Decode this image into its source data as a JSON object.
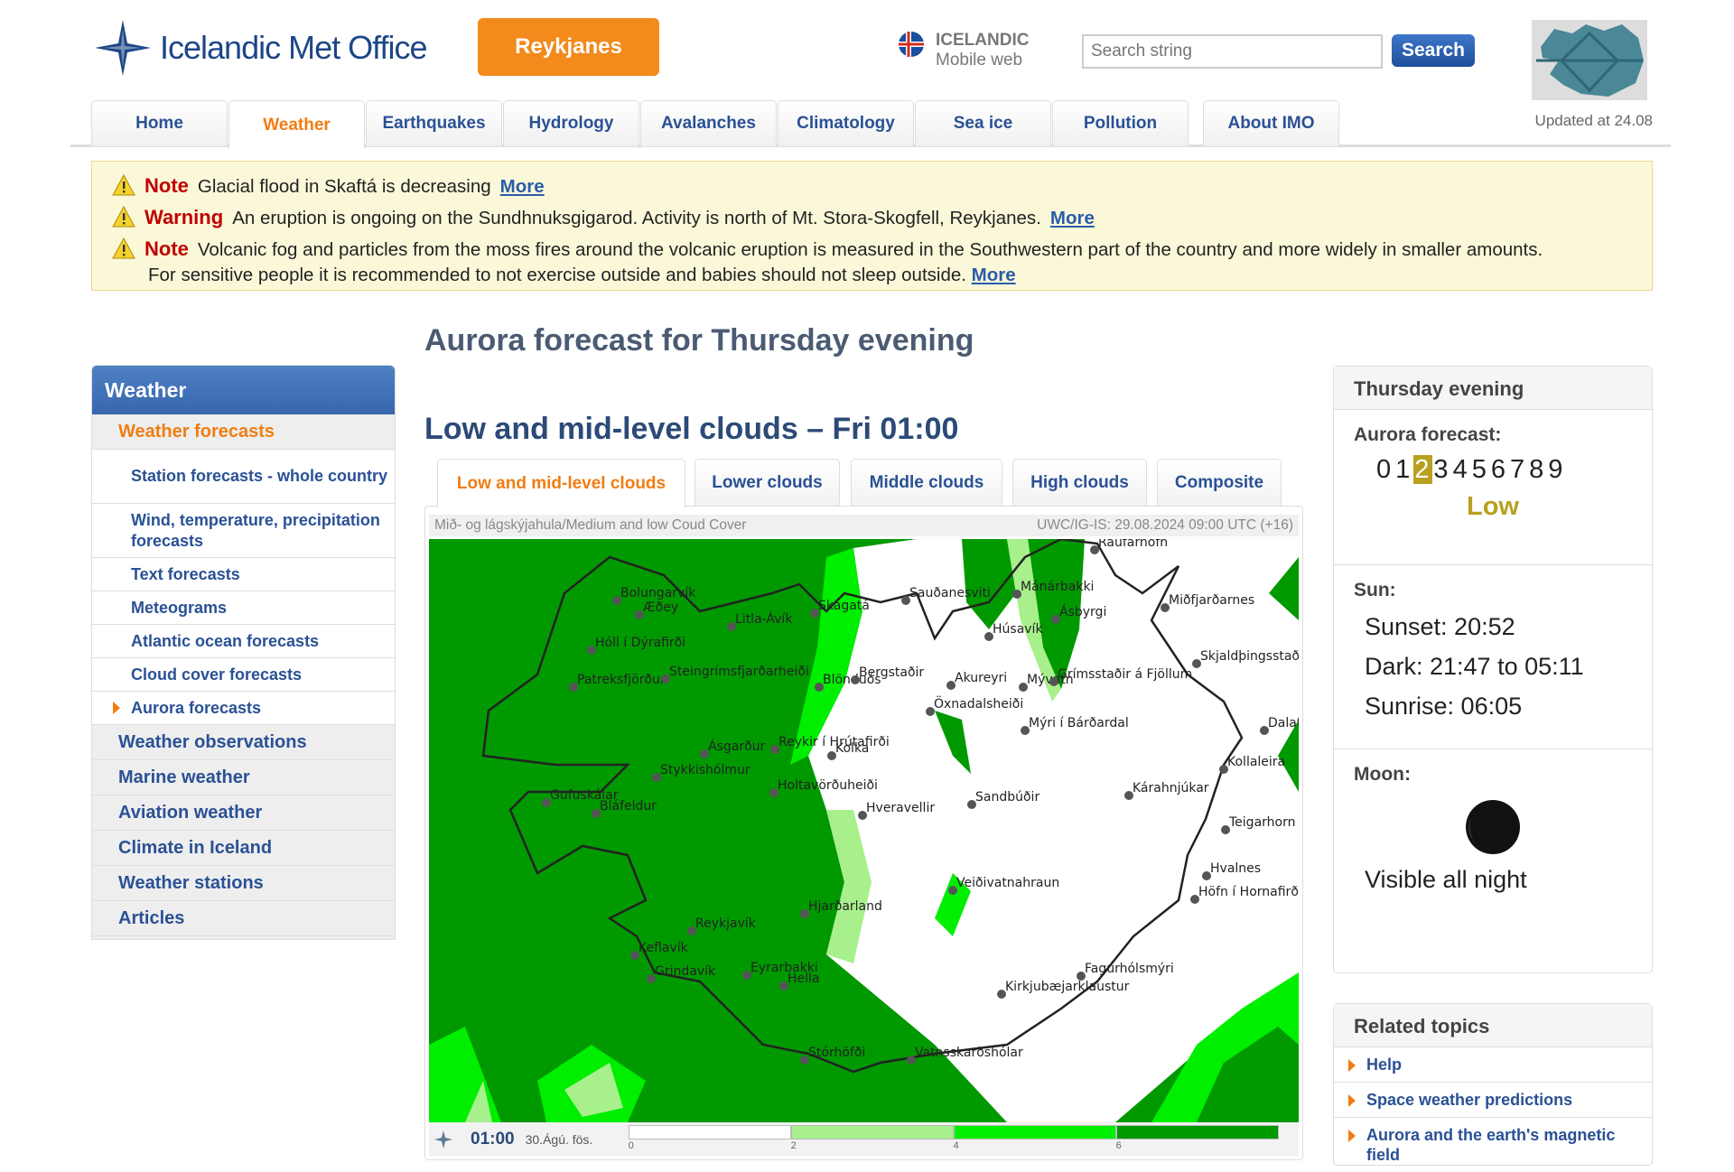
{
  "header": {
    "logo_text": "Icelandic Met Office",
    "region_button": "Reykjanes",
    "language_main": "ICELANDIC",
    "language_sub": "Mobile web",
    "search_placeholder": "Search string",
    "search_button": "Search",
    "updated": "Updated at 24.08"
  },
  "nav": {
    "tabs": [
      "Home",
      "Weather",
      "Earthquakes",
      "Hydrology",
      "Avalanches",
      "Climatology",
      "Sea ice",
      "Pollution",
      "About IMO"
    ],
    "active": "Weather"
  },
  "alerts": [
    {
      "kind": "Note",
      "text": "Glacial flood in Skaftá is decreasing",
      "link": "More"
    },
    {
      "kind": "Warning",
      "text": "An eruption is ongoing on the Sundhnuksgigarod. Activity is north of Mt. Stora-Skogfell, Reykjanes.",
      "link": "More"
    },
    {
      "kind": "Note",
      "text": "Volcanic fog and particles from the moss fires around the volcanic eruption is measured in the Southwestern part of the country and more widely in smaller amounts.",
      "text2": "For sensitive people it is recommended to not exercise outside and babies should not sleep outside.",
      "link": "More"
    }
  ],
  "sidebar": {
    "title": "Weather",
    "current": "Weather forecasts",
    "subitems": [
      "Station forecasts - whole country",
      "Wind, temperature, precipitation forecasts",
      "Text forecasts",
      "Meteograms",
      "Atlantic ocean forecasts",
      "Cloud cover forecasts",
      "Aurora forecasts"
    ],
    "active_subitem": "Aurora forecasts",
    "items": [
      "Weather observations",
      "Marine weather",
      "Aviation weather",
      "Climate in Iceland",
      "Weather stations",
      "Articles"
    ]
  },
  "main": {
    "title": "Aurora forecast for Thursday evening",
    "subtitle": "Low and mid-level clouds – Fri 01:00",
    "tabs": [
      "Low and mid-level clouds",
      "Lower clouds",
      "Middle clouds",
      "High clouds",
      "Composite"
    ],
    "active_tab": "Low and mid-level clouds",
    "map": {
      "caption_left": "Mið- og lágskýjahula/Medium and low Coud Cover",
      "caption_right": "UWC/IG-IS: 29.08.2024 09:00 UTC (+16)",
      "time": "01:00",
      "date": "30.Ágú. fös.",
      "legend_ticks": [
        "0",
        "2",
        "4",
        "6"
      ],
      "legend_colors": [
        "#ffffff",
        "#a8f08c",
        "#00ee00",
        "#009900"
      ],
      "places": [
        "Raufarhöfn",
        "Mánárbakki",
        "Ásbyrgi",
        "Miðfjarðarnes",
        "Sauðanesviti",
        "Húsavík",
        "Skagatá",
        "Litla-Ávík",
        "Bolungarvík",
        "Æðey",
        "Hóll í Dýrafirði",
        "Patreksfjörður",
        "Steingrímsfjarðarheiði",
        "Blönduós",
        "Bergstaðir",
        "Akureyri",
        "Mývatn",
        "Grímsstaðir á Fjöllum",
        "Skjaldþingsstaðir",
        "Öxnadalsheiði",
        "Mýri í Bárðardal",
        "Dalatangi",
        "Kollaleira",
        "Ásgarður",
        "Reykir í Hrútafirði",
        "Kolka",
        "Stykkishólmur",
        "Holtavörðuheiði",
        "Gufuskálar",
        "Bláfeldur",
        "Hveravellir",
        "Sandbúðir",
        "Kárahnjúkar",
        "Teigarhorn",
        "Hvalnes",
        "Höfn í Hornafirði",
        "Veiðivatnahraun",
        "Hjarðarland",
        "Reykjavík",
        "Keflavík",
        "Grindavík",
        "Eyrarbakki",
        "Hella",
        "Fagurhólsmýri",
        "Kirkjubæjarklaustur",
        "Stórhöfði",
        "Vatnsskarðshólar"
      ]
    }
  },
  "right": {
    "title": "Thursday evening",
    "aurora_label": "Aurora forecast:",
    "scale": [
      "0",
      "1",
      "2",
      "3",
      "4",
      "5",
      "6",
      "7",
      "8",
      "9"
    ],
    "aurora_value": 2,
    "aurora_level": "Low",
    "aurora_color": "#b8a020",
    "sun_label": "Sun:",
    "sunset": "Sunset: 20:52",
    "dark": "Dark: 21:47 to 05:11",
    "sunrise": "Sunrise: 06:05",
    "moon_label": "Moon:",
    "moon_text": "Visible all night"
  },
  "related": {
    "title": "Related topics",
    "items": [
      "Help",
      "Space weather predictions",
      "Aurora and the earth's magnetic field"
    ]
  }
}
